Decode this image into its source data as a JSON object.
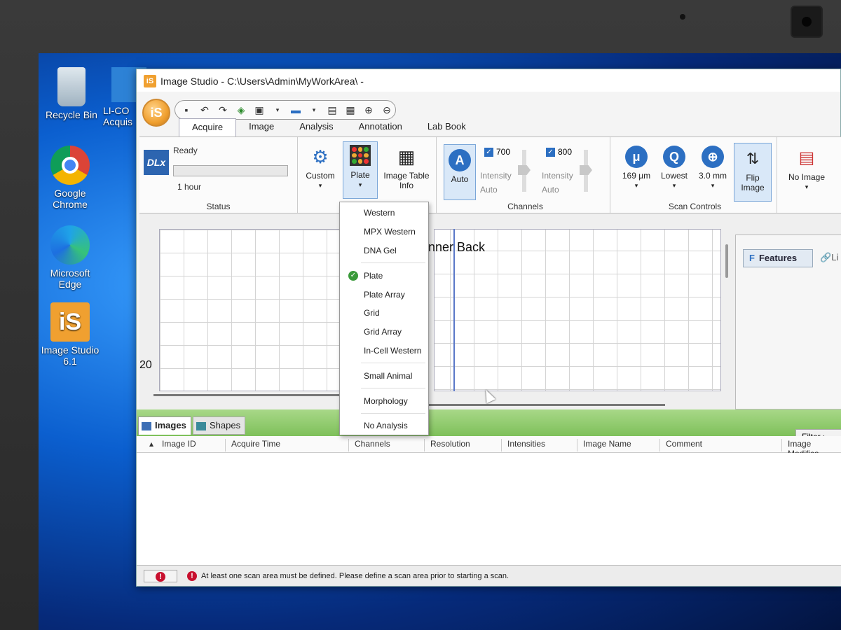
{
  "desktop": {
    "icons": [
      {
        "label": "Recycle Bin",
        "icon": "recycle-bin-icon"
      },
      {
        "label": "Google Chrome",
        "icon": "chrome-icon"
      },
      {
        "label": "Microsoft Edge",
        "icon": "edge-icon"
      },
      {
        "label": "Image Studio 6.1",
        "icon": "image-studio-icon"
      },
      {
        "label": "LI-CO Acquis",
        "icon": "li-cor-acquisition-icon"
      }
    ]
  },
  "window": {
    "title": "Image Studio - C:\\Users\\Admin\\MyWorkArea\\ -",
    "app_icon_text": "iS",
    "orb_text": "iS"
  },
  "tabs": [
    {
      "label": "Acquire",
      "active": true
    },
    {
      "label": "Image"
    },
    {
      "label": "Analysis"
    },
    {
      "label": "Annotation"
    },
    {
      "label": "Lab Book"
    }
  ],
  "ribbon": {
    "status": {
      "badge": "DLx",
      "state": "Ready",
      "time": "1 hour",
      "progress": 0,
      "group_label": "Status"
    },
    "custom_label": "Custom",
    "plate_label": "Plate",
    "image_table_info": "Image Table Info",
    "channels": {
      "auto_label": "Auto",
      "ch1": {
        "label": "700",
        "intensity": "Intensity",
        "mode": "Auto"
      },
      "ch2": {
        "label": "800",
        "intensity": "Intensity",
        "mode": "Auto"
      },
      "group_label": "Channels"
    },
    "scan_controls": {
      "resolution": "169 µm",
      "quality": "Lowest",
      "focus": "3.0 mm",
      "flip": "Flip Image",
      "group_label": "Scan Controls"
    },
    "no_image": "No Image"
  },
  "dropdown": {
    "items": [
      "Western",
      "MPX Western",
      "DNA Gel",
      "Plate",
      "Plate Array",
      "Grid",
      "Grid Array",
      "In-Cell Western",
      "Small Animal",
      "Morphology",
      "No Analysis"
    ],
    "selected": "Plate"
  },
  "content": {
    "panel_title": "nner Back",
    "axis_number": "20"
  },
  "features": {
    "tab": "Features",
    "tab2": "Li"
  },
  "bottom_tabs": [
    {
      "label": "Images"
    },
    {
      "label": "Shapes"
    }
  ],
  "filter_label": "Filter",
  "table": {
    "columns": [
      "Image ID",
      "Acquire Time",
      "Channels",
      "Resolution",
      "Intensities",
      "Image Name",
      "Comment",
      "Image Modifica"
    ]
  },
  "statusbar": {
    "message": "At least one scan area must be defined. Please define a scan area prior to starting a scan."
  }
}
